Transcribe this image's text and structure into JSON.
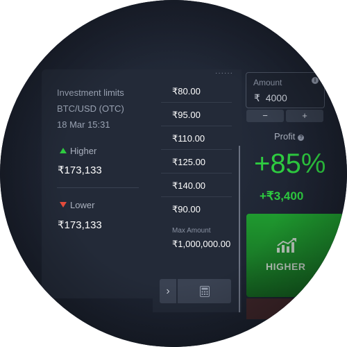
{
  "limits": {
    "title": "Investment limits",
    "pair": "BTC/USD (OTC)",
    "date": "18 Mar 15:31",
    "higher_label": "Higher",
    "higher_value": "₹173,133",
    "lower_label": "Lower",
    "lower_value": "₹173,133"
  },
  "quick_amounts": [
    "₹80.00",
    "₹95.00",
    "₹110.00",
    "₹125.00",
    "₹140.00",
    "₹90.00"
  ],
  "max_amount": {
    "label": "Max Amount",
    "value": "₹1,000,000.00"
  },
  "controls": {
    "arrow": "›",
    "calculator_icon": "calculator-icon"
  },
  "amount": {
    "label": "Amount",
    "currency": "₹",
    "value": "4000",
    "minus": "−",
    "plus": "+",
    "info_icon": "i"
  },
  "profit": {
    "label": "Profit",
    "info_icon": "?",
    "percent": "+85%",
    "amount": "+₹3,400"
  },
  "higher_button": {
    "label": "HIGHER",
    "icon": "chart-up-icon"
  },
  "colors": {
    "up": "#2ecc40",
    "down": "#e74c3c",
    "panel": "#232a38",
    "background": "#1c2230"
  }
}
